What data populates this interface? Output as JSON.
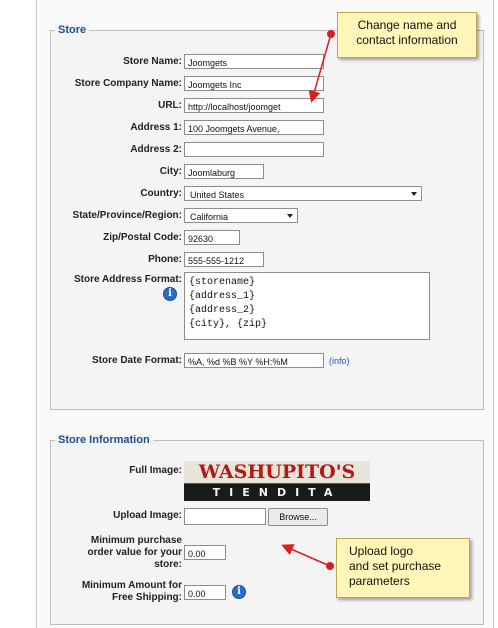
{
  "store_section": {
    "legend": "Store",
    "fields": {
      "store_name": {
        "label": "Store Name:",
        "value": "Joomgets"
      },
      "company_name": {
        "label": "Store Company Name:",
        "value": "Joomgets Inc"
      },
      "url": {
        "label": "URL:",
        "value": "http://localhost/joomget"
      },
      "address1": {
        "label": "Address 1:",
        "value": "100 Joomgets Avenue,"
      },
      "address2": {
        "label": "Address 2:",
        "value": ""
      },
      "city": {
        "label": "City:",
        "value": "Joomlaburg"
      },
      "country": {
        "label": "Country:",
        "value": "United States"
      },
      "state": {
        "label": "State/Province/Region:",
        "value": "California"
      },
      "zip": {
        "label": "Zip/Postal Code:",
        "value": "92630"
      },
      "phone": {
        "label": "Phone:",
        "value": "555-555-1212"
      },
      "address_format": {
        "label": "Store Address Format:",
        "lines": [
          "{storename}",
          "{address_1}",
          "{address_2}",
          "{city}, {zip}"
        ]
      },
      "date_format": {
        "label": "Store Date Format:",
        "value": "%A, %d %B %Y %H:%M",
        "info_link": "(info)"
      }
    }
  },
  "store_info_section": {
    "legend": "Store Information",
    "full_image_label": "Full Image:",
    "logo": {
      "line1": "WASHUPITO'S",
      "line2": "TIENDITA"
    },
    "upload_label": "Upload Image:",
    "upload_value": "",
    "browse_label": "Browse...",
    "min_order": {
      "label": "Minimum purchase order value for your store:",
      "value": "0.00"
    },
    "min_free_shipping": {
      "label": "Minimum Amount for Free Shipping:",
      "value": "0.00"
    }
  },
  "callouts": {
    "top": "Change name and contact information",
    "bottom_line1": "Upload logo",
    "bottom_line2": "and set purchase parameters"
  },
  "colors": {
    "legend": "#1f4f8a",
    "callout_bg": "#fff6b8",
    "arrow_red": "#d92020",
    "info_icon": "#2a6cc9"
  },
  "icons": {
    "info": "info-icon",
    "dropdown": "chevron-down-icon"
  }
}
